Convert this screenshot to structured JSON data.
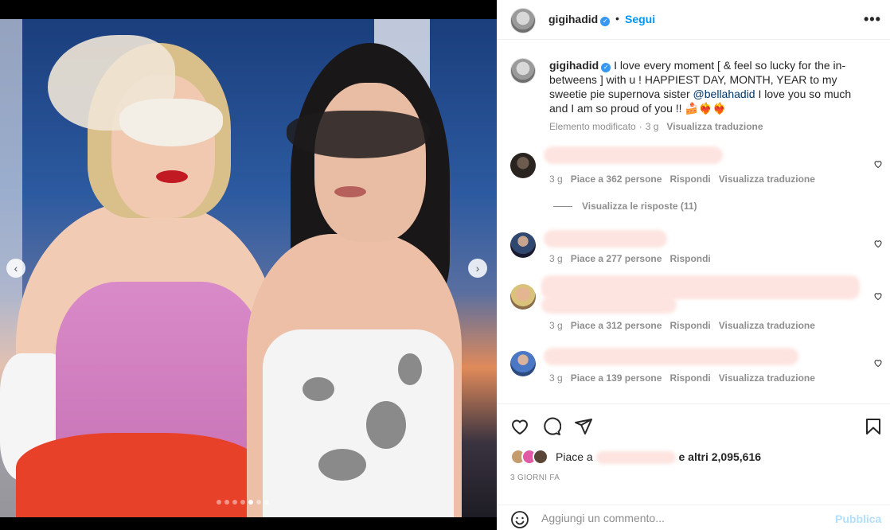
{
  "post": {
    "username": "gigihadid",
    "follow_label": "Segui",
    "bullet": "•",
    "more_label": "•••",
    "verified_glyph": "✓"
  },
  "media": {
    "prev_glyph": "‹",
    "next_glyph": "›",
    "slide_count": 7,
    "active_slide": 5
  },
  "caption": {
    "username": "gigihadid",
    "text_before_mention": " I love every moment [ & feel so lucky for the in-betweens ] with u ! HAPPIEST DAY, MONTH, YEAR to my sweetie pie supernova sister ",
    "mention": "@bellahadid",
    "text_after_mention": " I love you so much and I am so proud of you !! 🍰❤️‍🔥❤️‍🔥",
    "edited_label": "Elemento modificato",
    "separator": "·",
    "time": "3 g",
    "translate_label": "Visualizza traduzione"
  },
  "comments": [
    {
      "time": "3 g",
      "likes": "Piace a 362 persone",
      "reply": "Rispondi",
      "translate": "Visualizza traduzione"
    },
    {
      "time": "3 g",
      "likes": "Piace a 277 persone",
      "reply": "Rispondi",
      "translate": ""
    },
    {
      "time": "3 g",
      "likes": "Piace a 312 persone",
      "reply": "Rispondi",
      "translate": "Visualizza traduzione"
    },
    {
      "time": "3 g",
      "likes": "Piace a 139 persone",
      "reply": "Rispondi",
      "translate": "Visualizza traduzione"
    }
  ],
  "replies_label": "Visualizza le risposte (11)",
  "likes": {
    "prefix": "Piace a",
    "suffix_before_count": "e altri",
    "count": "2,095,616"
  },
  "posted_ago": "3 GIORNI FA",
  "comment_box": {
    "placeholder": "Aggiungi un commento...",
    "publish_label": "Pubblica"
  },
  "colors": {
    "accent": "#0095f6",
    "verified": "#3897f0",
    "publish_disabled": "#b2dffc",
    "secondary_text": "#8e8e8e"
  }
}
